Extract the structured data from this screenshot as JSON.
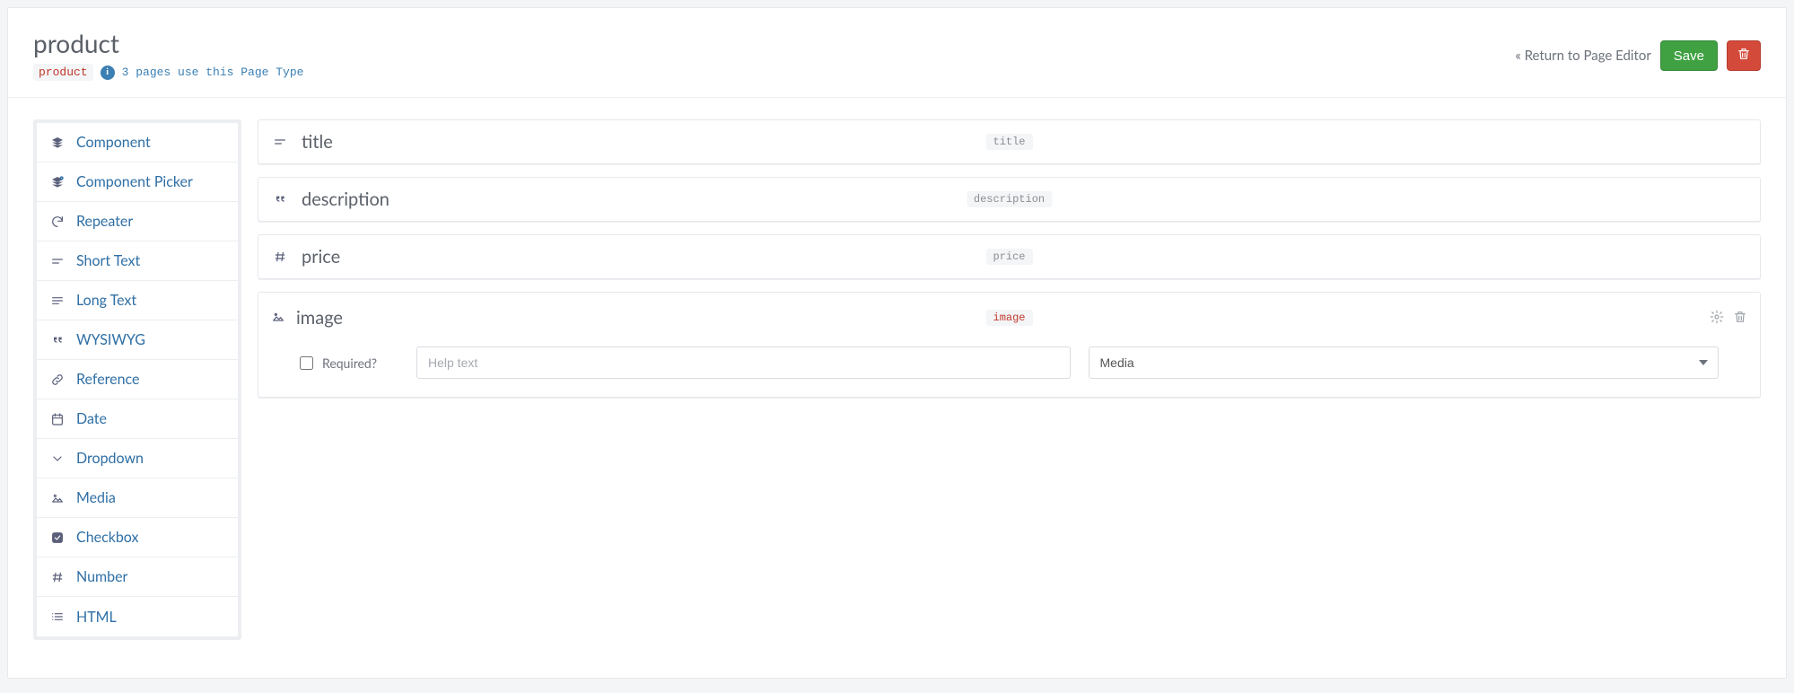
{
  "header": {
    "title": "product",
    "slug": "product",
    "usage_text": "3 pages use this Page Type",
    "return_label": "« Return to Page Editor",
    "save_label": "Save"
  },
  "sidebar": {
    "items": [
      {
        "label": "Component",
        "icon": "layers-icon"
      },
      {
        "label": "Component Picker",
        "icon": "layers-plus-icon"
      },
      {
        "label": "Repeater",
        "icon": "reload-icon"
      },
      {
        "label": "Short Text",
        "icon": "short-text-icon"
      },
      {
        "label": "Long Text",
        "icon": "long-text-icon"
      },
      {
        "label": "WYSIWYG",
        "icon": "quote-icon"
      },
      {
        "label": "Reference",
        "icon": "link-icon"
      },
      {
        "label": "Date",
        "icon": "calendar-icon"
      },
      {
        "label": "Dropdown",
        "icon": "chevron-down-icon"
      },
      {
        "label": "Media",
        "icon": "image-icon"
      },
      {
        "label": "Checkbox",
        "icon": "checkbox-icon"
      },
      {
        "label": "Number",
        "icon": "hash-icon"
      },
      {
        "label": "HTML",
        "icon": "list-icon"
      }
    ]
  },
  "fields": [
    {
      "label": "title",
      "slug": "title",
      "icon": "short-text-icon",
      "expanded": false
    },
    {
      "label": "description",
      "slug": "description",
      "icon": "quote-icon",
      "expanded": false
    },
    {
      "label": "price",
      "slug": "price",
      "icon": "hash-icon",
      "expanded": false
    }
  ],
  "expanded_field": {
    "label": "image",
    "slug": "image",
    "icon": "image-icon",
    "required_label": "Required?",
    "required_checked": false,
    "help_placeholder": "Help text",
    "type_selected": "Media",
    "type_options": [
      "Media"
    ]
  }
}
